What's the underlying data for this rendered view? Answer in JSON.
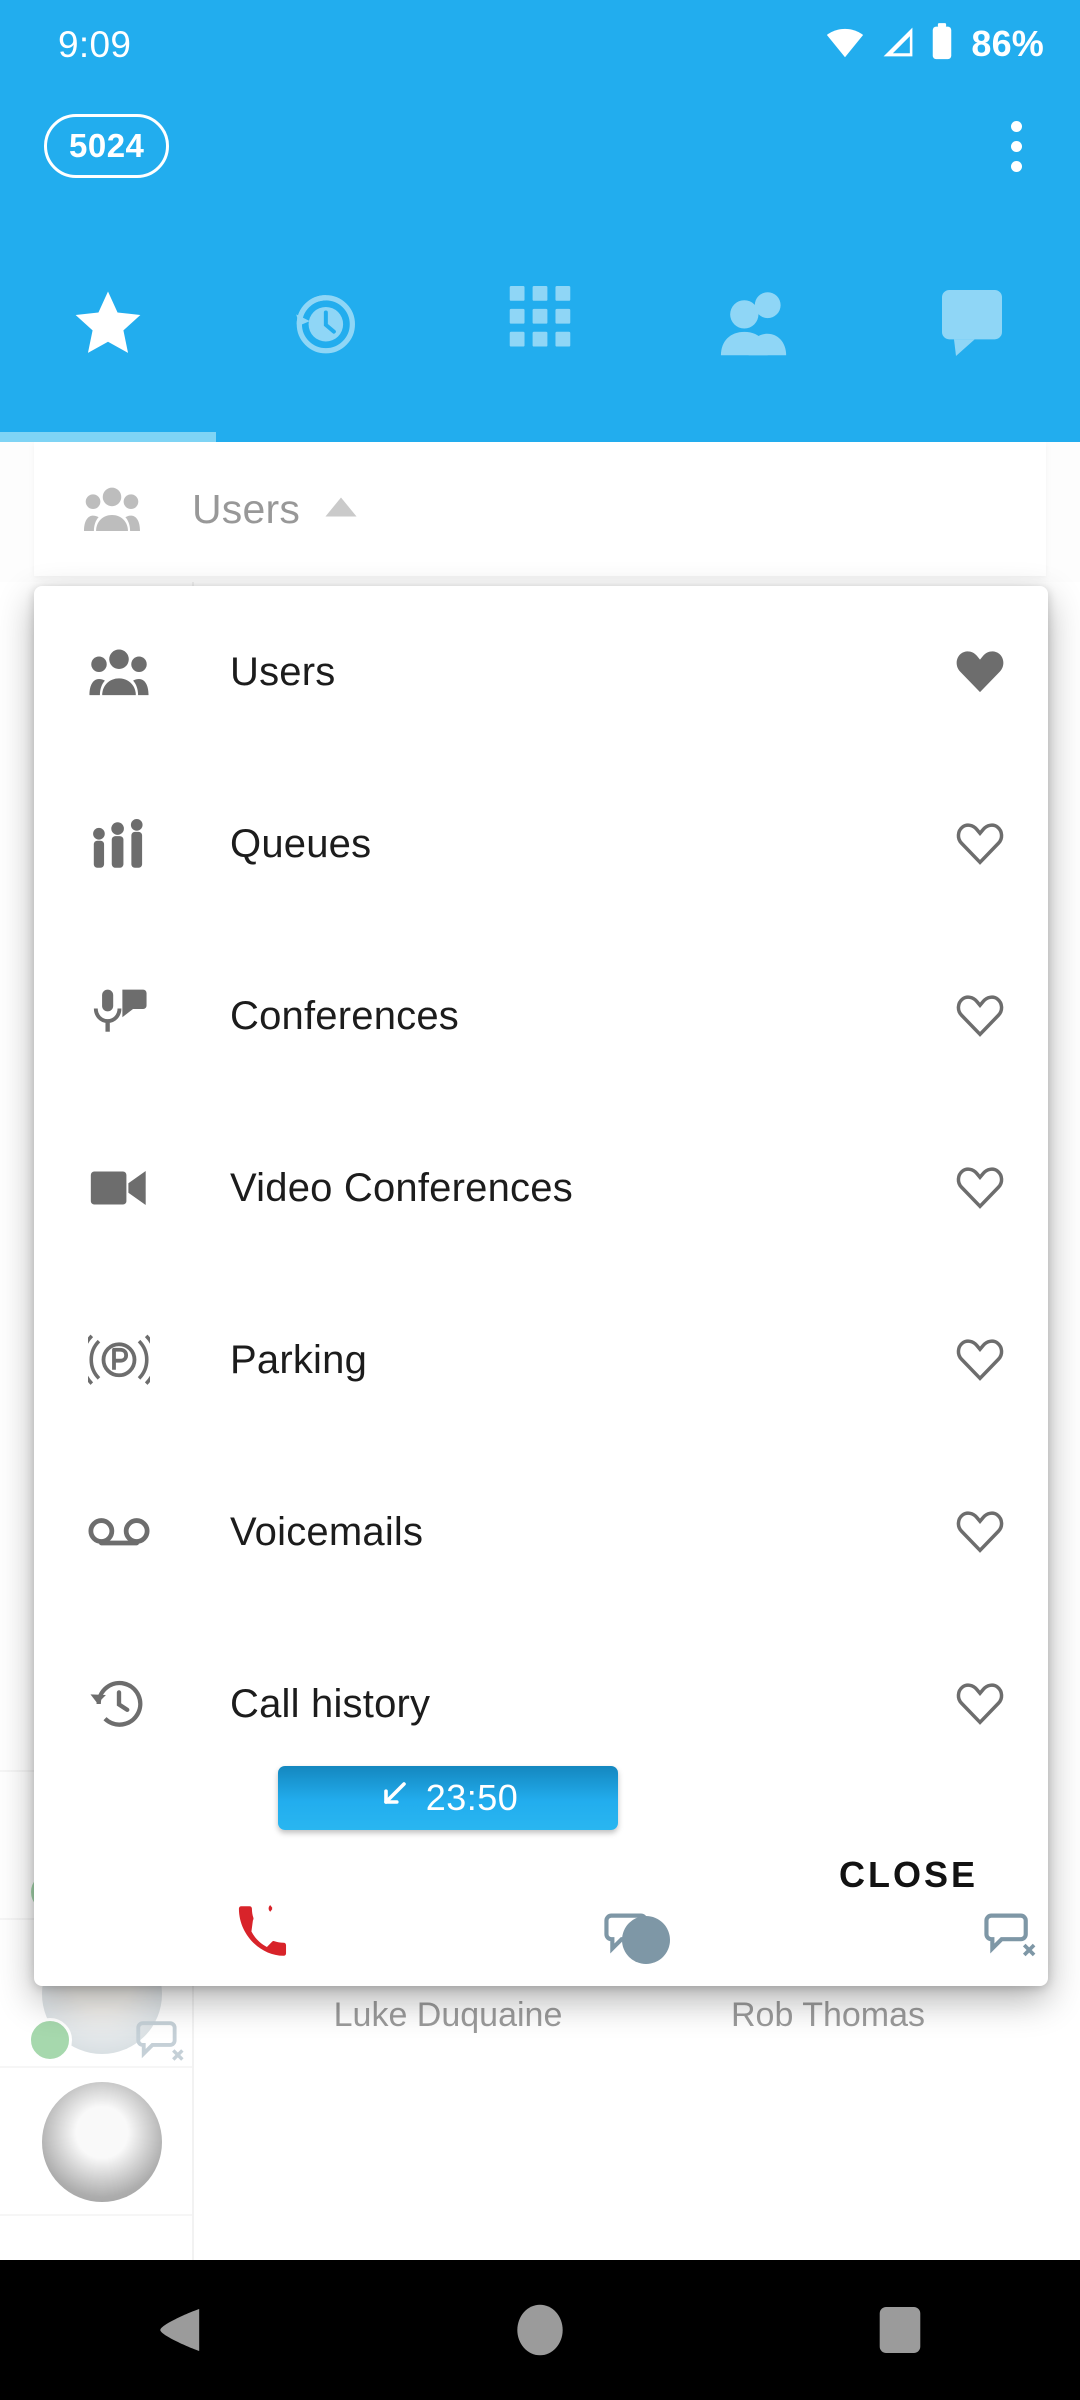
{
  "status_bar": {
    "clock": "9:09",
    "battery_percent": "86%",
    "icons": [
      "wifi-icon",
      "cellular-signal-icon",
      "battery-icon"
    ]
  },
  "app_bar": {
    "extension_chip": "5024",
    "overflow_menu": "more-options-icon"
  },
  "tabs": [
    {
      "name": "favorites",
      "icon": "star-icon",
      "selected": true
    },
    {
      "name": "call-history",
      "icon": "history-clock-icon",
      "selected": false
    },
    {
      "name": "keypad",
      "icon": "dialpad-grid-icon",
      "selected": false
    },
    {
      "name": "contacts",
      "icon": "people-icon",
      "selected": false
    },
    {
      "name": "messages",
      "icon": "chat-bubble-icon",
      "selected": false
    }
  ],
  "section_header": {
    "icon": "people-icon",
    "label": "Users",
    "caret": "caret-up-icon"
  },
  "dialog": {
    "items": [
      {
        "icon": "people-icon",
        "label": "Users",
        "favorite": true
      },
      {
        "icon": "queue-people-icon",
        "label": "Queues",
        "favorite": false
      },
      {
        "icon": "microphone-chat-icon",
        "label": "Conferences",
        "favorite": false
      },
      {
        "icon": "video-camera-icon",
        "label": "Video Conferences",
        "favorite": false
      },
      {
        "icon": "parking-p-icon",
        "label": "Parking",
        "favorite": false
      },
      {
        "icon": "voicemail-icon",
        "label": "Voicemails",
        "favorite": false
      },
      {
        "icon": "history-clock-icon",
        "label": "Call history",
        "favorite": false
      }
    ],
    "close_label": "CLOSE"
  },
  "contacts_grid": [
    {
      "name": "Luke Duquaine",
      "presence": "busy",
      "presence_color": "#7e97a6",
      "call_badge": {
        "direction_icon": "incoming-call-arrow-icon",
        "duration": "23:50"
      },
      "chat_status": "chat-disabled-icon",
      "ringing": true
    },
    {
      "name": "Rob Thomas",
      "presence": "away",
      "presence_color": "#7e97a6",
      "call_badge": null,
      "chat_status": "chat-disabled-icon",
      "ringing": false
    }
  ],
  "left_list": [
    {
      "presence_color": "#3aa94a",
      "chat_status": "chat-icon"
    },
    {
      "presence_color": "#3aa94a",
      "chat_status": "chat-disabled-icon"
    },
    {
      "presence_color": "#3aa94a",
      "chat_status": "chat-disabled-icon"
    }
  ],
  "nav_bar": {
    "back": "back-triangle-icon",
    "home": "home-circle-icon",
    "recents": "recents-square-icon"
  },
  "colors": {
    "brand_blue": "#22ADEE",
    "tab_indicator": "#7FD4F5",
    "online_green": "#3aa94a",
    "ring_red": "#d8232a",
    "icon_gray": "#6d6d6d"
  }
}
